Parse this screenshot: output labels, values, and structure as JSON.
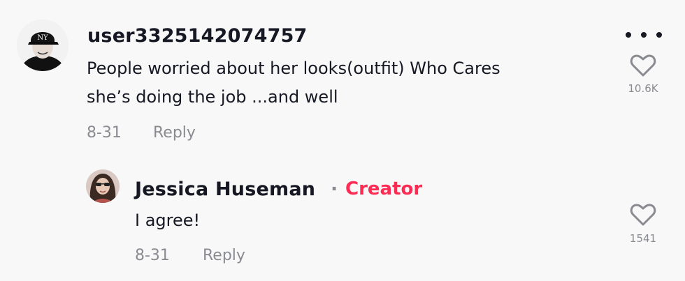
{
  "main_comment": {
    "username": "user3325142074757",
    "text_lines": [
      "People worried about her looks(outfit) Who Cares",
      "she’s doing the job ...and well"
    ],
    "date": "8-31",
    "reply_label": "Reply",
    "like_count": "10.6K",
    "avatar_icon": "user-avatar-yankees-cap-icon"
  },
  "reply_comment": {
    "username": "Jessica Huseman",
    "separator": "·",
    "badge": "Creator",
    "badge_color": "#fe2c55",
    "text": "I agree!",
    "date": "8-31",
    "reply_label": "Reply",
    "like_count": "1541",
    "avatar_icon": "user-avatar-icon"
  },
  "icons": {
    "more": "more-options-icon",
    "like": "heart-outline-icon"
  },
  "colors": {
    "background": "#f8f8f8",
    "text_primary": "#161823",
    "text_secondary": "#8a8b91",
    "creator_accent": "#fe2c55"
  }
}
